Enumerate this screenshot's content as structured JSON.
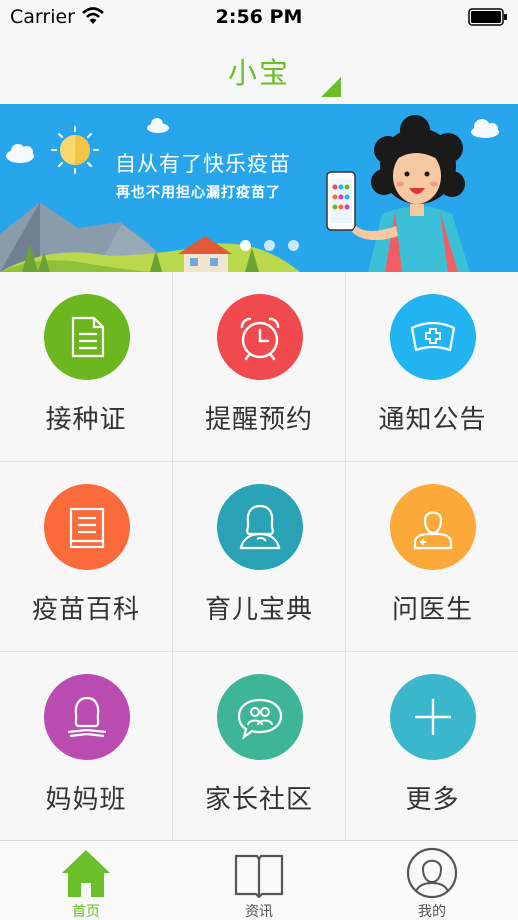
{
  "status_bar": {
    "carrier": "Carrier",
    "time": "2:56 PM"
  },
  "header": {
    "title": "小宝"
  },
  "banner": {
    "title": "自从有了快乐疫苗",
    "subtitle": "再也不用担心漏打疫苗了",
    "page_count": 3,
    "active_page": 1
  },
  "grid": {
    "items": [
      {
        "label": "接种证",
        "icon": "document-icon",
        "color": "#6cb61f"
      },
      {
        "label": "提醒预约",
        "icon": "alarm-clock-icon",
        "color": "#f04a4f"
      },
      {
        "label": "通知公告",
        "icon": "nurse-cap-icon",
        "color": "#21b4f0"
      },
      {
        "label": "疫苗百科",
        "icon": "book-icon",
        "color": "#fb6a3a"
      },
      {
        "label": "育儿宝典",
        "icon": "mother-icon",
        "color": "#29a3b5"
      },
      {
        "label": "问医生",
        "icon": "doctor-icon",
        "color": "#fba938"
      },
      {
        "label": "妈妈班",
        "icon": "reading-woman-icon",
        "color": "#ba4bb0"
      },
      {
        "label": "家长社区",
        "icon": "community-chat-icon",
        "color": "#3fb598"
      },
      {
        "label": "更多",
        "icon": "plus-icon",
        "color": "#3ab7cb"
      }
    ]
  },
  "tabbar": {
    "tabs": [
      {
        "label": "首页",
        "icon": "home-icon",
        "active": true
      },
      {
        "label": "资讯",
        "icon": "open-book-icon",
        "active": false
      },
      {
        "label": "我的",
        "icon": "user-profile-icon",
        "active": false
      }
    ]
  },
  "colors": {
    "accent": "#6abf2a",
    "banner_bg": "#28a6eb"
  }
}
